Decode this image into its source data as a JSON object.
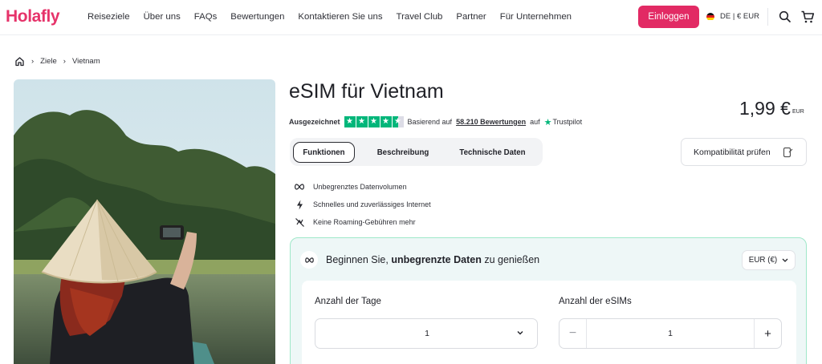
{
  "header": {
    "logo": "Holafly",
    "nav": [
      "Reiseziele",
      "Über uns",
      "FAQs",
      "Bewertungen",
      "Kontaktieren Sie uns",
      "Travel Club",
      "Partner",
      "Für Unternehmen"
    ],
    "login_label": "Einloggen",
    "locale_label": "DE | € EUR",
    "icons": [
      "search-icon",
      "cart-icon"
    ],
    "brand_color": "#e22a64"
  },
  "breadcrumb": {
    "items": [
      "Ziele",
      "Vietnam"
    ]
  },
  "product": {
    "title": "eSIM für Vietnam",
    "price": "1,99 €",
    "price_currency": "EUR",
    "rating": {
      "label": "Ausgezeichnet",
      "stars": 4.5,
      "based_on": "Basierend auf",
      "reviews": "58.210 Bewertungen",
      "on": "auf",
      "source": "Trustpilot"
    },
    "tabs": [
      "Funktionen",
      "Beschreibung",
      "Technische Daten"
    ],
    "active_tab": "Funktionen",
    "compat_label": "Kompatibilität prüfen",
    "features": [
      {
        "icon": "infinity-icon",
        "text": "Unbegrenztes Datenvolumen"
      },
      {
        "icon": "lightning-icon",
        "text": "Schnelles und zuverlässiges Internet"
      },
      {
        "icon": "no-roaming-icon",
        "text": "Keine Roaming-Gebühren mehr"
      }
    ]
  },
  "plan": {
    "headline_prefix": "Beginnen Sie,",
    "headline_bold": "unbegrenzte Daten",
    "headline_suffix": "zu genießen",
    "currency": "EUR (€)",
    "days_label": "Anzahl der Tage",
    "days_value": "1",
    "esims_label": "Anzahl der eSIMs",
    "esims_value": "1"
  }
}
